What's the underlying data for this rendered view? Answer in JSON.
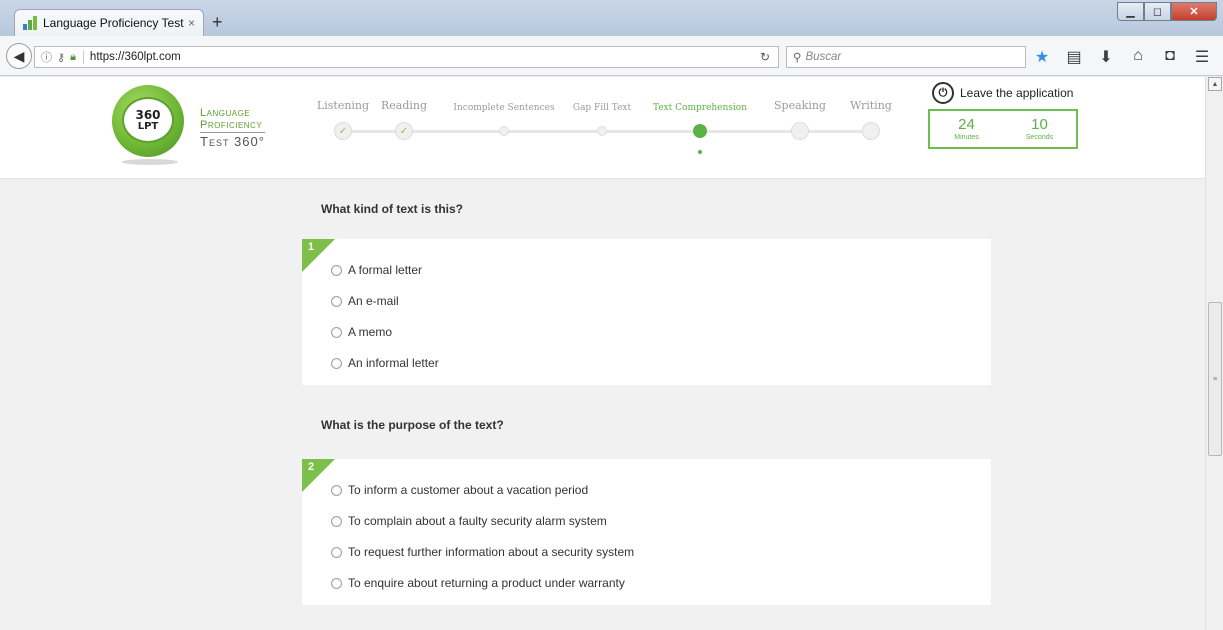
{
  "browser": {
    "tab_title": "Language Proficiency Test ...",
    "tab_close": "×",
    "new_tab": "+",
    "url": "https://360lpt.com",
    "search_placeholder": "Buscar",
    "icons": [
      "star-icon",
      "reading-list-icon",
      "download-icon",
      "home-icon",
      "pocket-icon",
      "menu-icon"
    ]
  },
  "logo": {
    "number": "360",
    "abbr": "LPT",
    "line1": "Language",
    "line2": "Proficiency",
    "line3": "Test 360°"
  },
  "steps": [
    {
      "label": "Listening",
      "status": "done"
    },
    {
      "label": "Reading",
      "status": "done"
    },
    {
      "label": "Incomplete Sentences",
      "status": "pending"
    },
    {
      "label": "Gap Fill Text",
      "status": "pending"
    },
    {
      "label": "Text Comprehension",
      "status": "active"
    },
    {
      "label": "Speaking",
      "status": "pending"
    },
    {
      "label": "Writing",
      "status": "pending"
    }
  ],
  "leave_label": "Leave the application",
  "timer": {
    "minutes": "24",
    "minutes_label": "Minutes",
    "seconds": "10",
    "seconds_label": "Seconds"
  },
  "questions": [
    {
      "number": "1",
      "text": "What kind of text is this?",
      "options": [
        "A formal letter",
        "An e-mail",
        "A memo",
        "An informal letter"
      ]
    },
    {
      "number": "2",
      "text": "What is the purpose of the text?",
      "options": [
        "To inform a customer about a vacation period",
        "To complain about a faulty security alarm system",
        "To request further information about a security system",
        "To enquire about returning a product under warranty"
      ]
    }
  ],
  "colors": {
    "accent": "#5cb245",
    "badge": "#7cc04b",
    "background": "#f1f1f1"
  }
}
